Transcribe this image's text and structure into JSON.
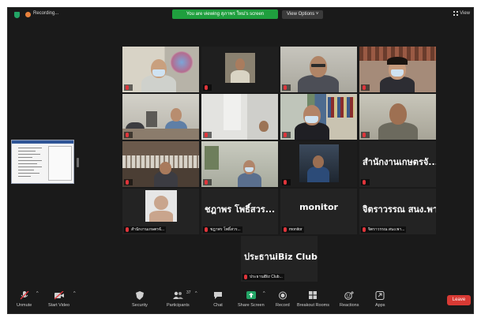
{
  "topbar": {
    "recording_label": "Recording...",
    "share_banner": "You are viewing สุภาพร ใหม่'s screen",
    "view_options_label": "View Options ˅",
    "grid_view_label": "View"
  },
  "tiles": [
    {
      "label": ""
    },
    {
      "label": ""
    },
    {
      "label": ""
    },
    {
      "label": ""
    },
    {
      "label": ""
    },
    {
      "label": ""
    },
    {
      "label": ""
    },
    {
      "label": ""
    },
    {
      "label": ""
    },
    {
      "label": ""
    },
    {
      "label": ""
    },
    {
      "label": "สำนักงานเกษตรจั..."
    },
    {
      "label": ""
    },
    {
      "label": "ชฎาพร โพธิ์สวร..."
    },
    {
      "label": "monitor"
    },
    {
      "label": "จิตราวรรณ สนง.พา..."
    },
    {
      "label": "ประธานiBiz Club..."
    }
  ],
  "big_names": {
    "t12": "สำนักงานเกษตรจั...",
    "t14": "ชฎาพร โพธิ์สวร...",
    "t15": "monitor",
    "t16": "จิตราวรรณ สนง.พา...",
    "t17": "ประธานiBiz Club..."
  },
  "toolbar": {
    "unmute": "Unmute",
    "start_video": "Start Video",
    "security": "Security",
    "participants": "Participants",
    "participants_count": "37",
    "chat": "Chat",
    "share_screen": "Share Screen",
    "record": "Record",
    "breakout_rooms": "Breakout Rooms",
    "reactions": "Reactions",
    "apps": "Apps",
    "leave": "Leave"
  },
  "colors": {
    "background": "#1a1a1a",
    "share_banner": "#1f9f3e",
    "active_speaker": "#8fd14f",
    "muted_mic": "#e0353b",
    "leave": "#d83a34"
  }
}
